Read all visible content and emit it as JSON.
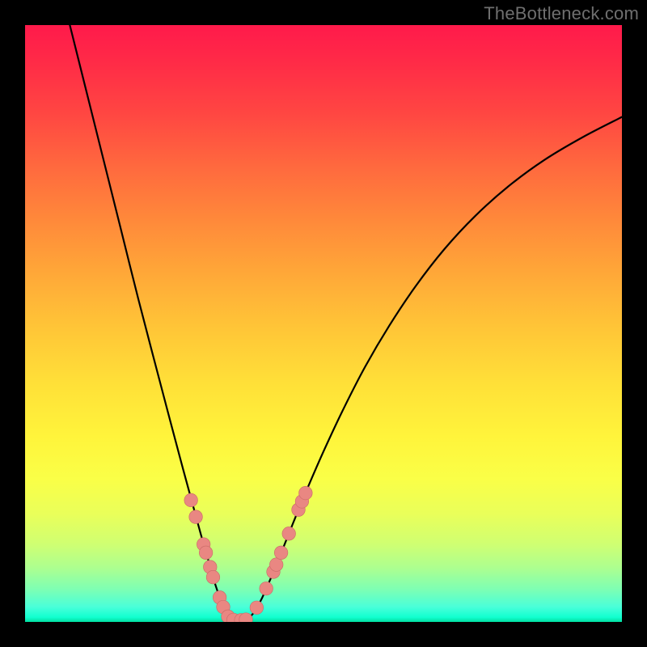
{
  "watermark": "TheBottleneck.com",
  "colors": {
    "frame": "#000000",
    "curve": "#000000",
    "dot_fill": "#e98782",
    "dot_stroke": "#c96a66"
  },
  "chart_data": {
    "type": "line",
    "title": "",
    "xlabel": "",
    "ylabel": "",
    "xlim": [
      0,
      100
    ],
    "ylim": [
      0,
      100
    ],
    "curve": {
      "note": "y is 0 at bottom, 100 at top; x is 0 at left, 100 at right",
      "points": [
        {
          "x": 7.5,
          "y": 100.0
        },
        {
          "x": 10.0,
          "y": 90.0
        },
        {
          "x": 13.0,
          "y": 78.0
        },
        {
          "x": 16.0,
          "y": 66.0
        },
        {
          "x": 19.0,
          "y": 54.0
        },
        {
          "x": 22.0,
          "y": 42.5
        },
        {
          "x": 24.5,
          "y": 33.0
        },
        {
          "x": 26.5,
          "y": 25.5
        },
        {
          "x": 28.0,
          "y": 20.0
        },
        {
          "x": 29.5,
          "y": 14.5
        },
        {
          "x": 30.8,
          "y": 10.0
        },
        {
          "x": 31.8,
          "y": 6.5
        },
        {
          "x": 32.8,
          "y": 3.6
        },
        {
          "x": 33.6,
          "y": 1.6
        },
        {
          "x": 34.4,
          "y": 0.6
        },
        {
          "x": 35.4,
          "y": 0.25
        },
        {
          "x": 36.4,
          "y": 0.25
        },
        {
          "x": 37.4,
          "y": 0.6
        },
        {
          "x": 38.4,
          "y": 1.7
        },
        {
          "x": 39.7,
          "y": 4.0
        },
        {
          "x": 41.2,
          "y": 7.4
        },
        {
          "x": 43.0,
          "y": 11.8
        },
        {
          "x": 45.0,
          "y": 16.8
        },
        {
          "x": 47.4,
          "y": 22.6
        },
        {
          "x": 50.2,
          "y": 29.0
        },
        {
          "x": 53.4,
          "y": 35.8
        },
        {
          "x": 57.0,
          "y": 42.8
        },
        {
          "x": 61.0,
          "y": 49.6
        },
        {
          "x": 65.4,
          "y": 56.2
        },
        {
          "x": 70.2,
          "y": 62.4
        },
        {
          "x": 75.4,
          "y": 68.0
        },
        {
          "x": 81.0,
          "y": 73.0
        },
        {
          "x": 87.0,
          "y": 77.4
        },
        {
          "x": 93.4,
          "y": 81.2
        },
        {
          "x": 100.0,
          "y": 84.6
        }
      ]
    },
    "dots": [
      {
        "x": 27.8,
        "y": 20.4
      },
      {
        "x": 28.6,
        "y": 17.6
      },
      {
        "x": 29.9,
        "y": 13.0
      },
      {
        "x": 30.3,
        "y": 11.6
      },
      {
        "x": 31.0,
        "y": 9.2
      },
      {
        "x": 31.5,
        "y": 7.5
      },
      {
        "x": 32.6,
        "y": 4.1
      },
      {
        "x": 33.2,
        "y": 2.5
      },
      {
        "x": 34.0,
        "y": 0.9
      },
      {
        "x": 34.9,
        "y": 0.35
      },
      {
        "x": 36.2,
        "y": 0.3
      },
      {
        "x": 37.0,
        "y": 0.4
      },
      {
        "x": 38.8,
        "y": 2.4
      },
      {
        "x": 40.4,
        "y": 5.6
      },
      {
        "x": 41.6,
        "y": 8.4
      },
      {
        "x": 42.1,
        "y": 9.6
      },
      {
        "x": 42.9,
        "y": 11.6
      },
      {
        "x": 44.2,
        "y": 14.8
      },
      {
        "x": 45.8,
        "y": 18.8
      },
      {
        "x": 46.4,
        "y": 20.2
      },
      {
        "x": 47.0,
        "y": 21.6
      }
    ],
    "dot_radius_px": 8.3
  }
}
